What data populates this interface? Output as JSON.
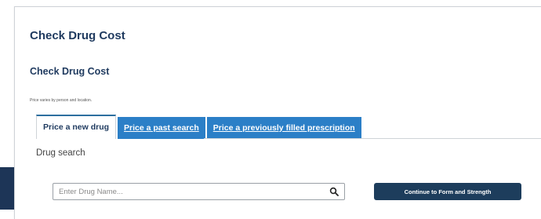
{
  "page": {
    "title": "Check Drug Cost",
    "section_title": "Check Drug Cost",
    "note": "Price varies by person and location."
  },
  "tabs": [
    {
      "label": "Price a new drug",
      "active": true
    },
    {
      "label": "Price a past search",
      "active": false
    },
    {
      "label": "Price a previously filled prescription",
      "active": false
    }
  ],
  "panel": {
    "heading": "Drug search",
    "search": {
      "placeholder": "Enter Drug Name...",
      "value": "",
      "icon": "search-icon"
    },
    "continue_label": "Continue to Form and Strength"
  },
  "colors": {
    "title": "#1f3a5f",
    "tab_active_border": "#2d6f9f",
    "tab_inactive_bg": "#2b7fc7",
    "button_bg": "#1d3d5c",
    "background_accent": "#1d3557"
  }
}
